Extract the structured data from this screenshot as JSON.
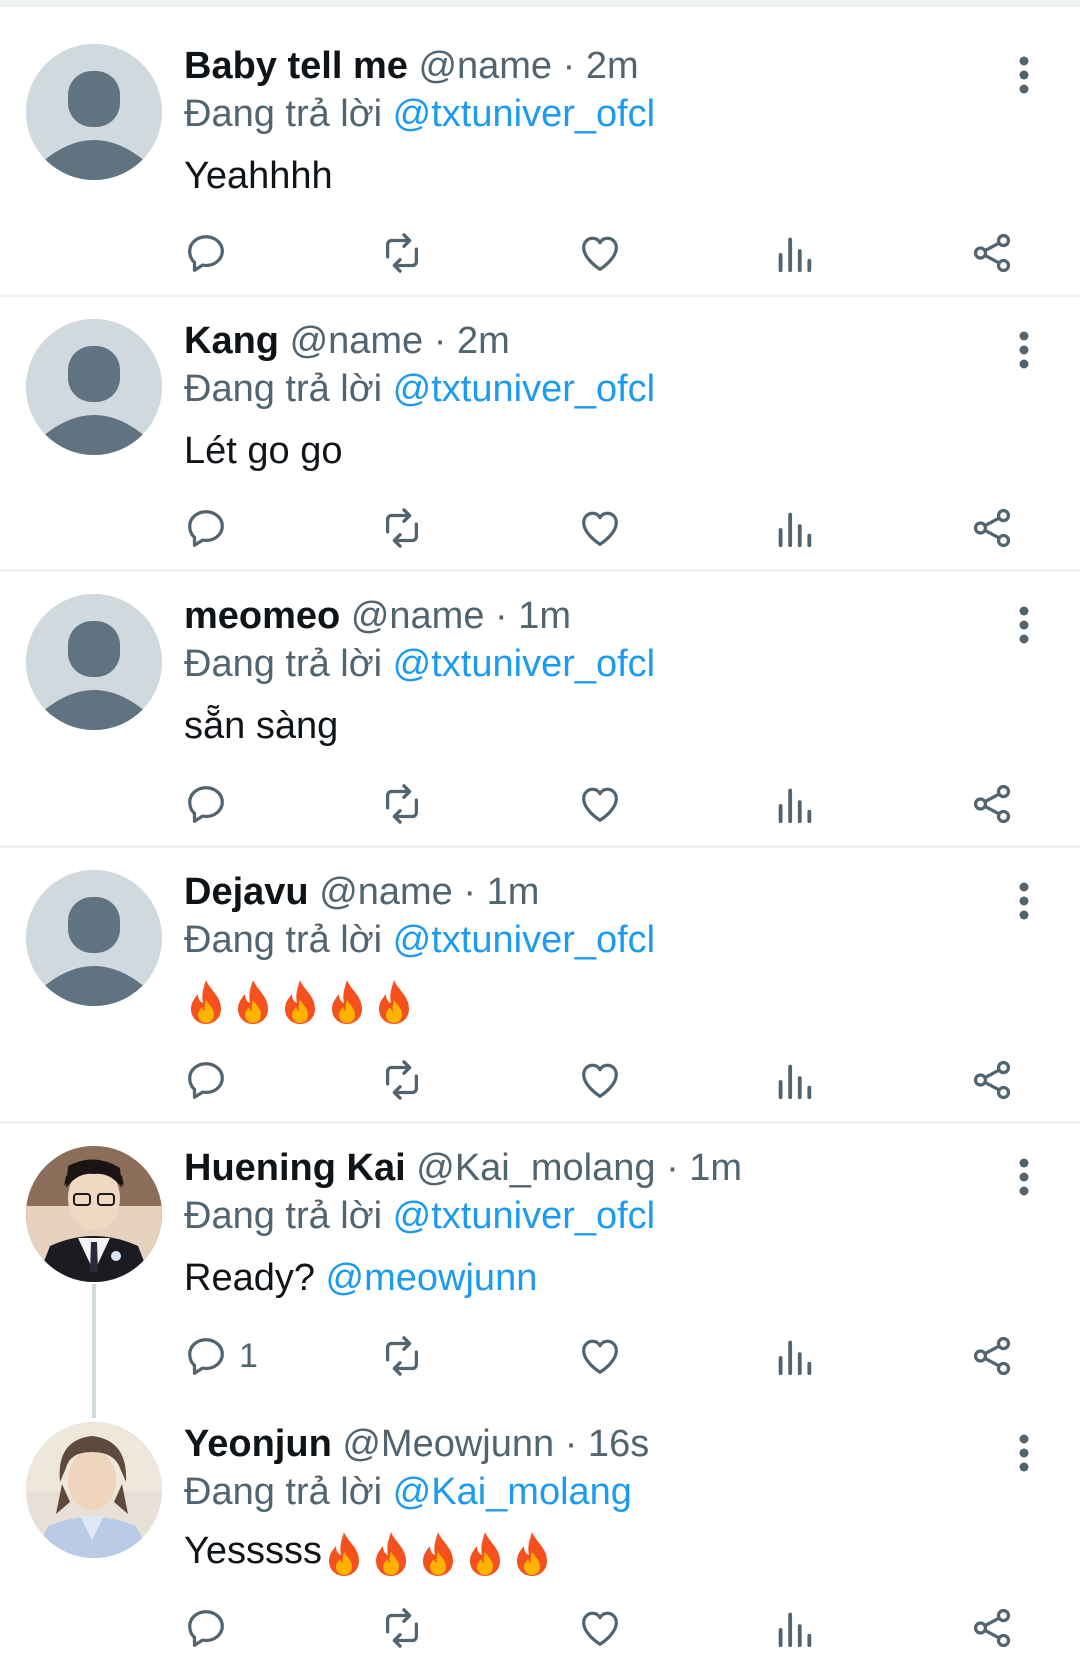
{
  "tweets": [
    {
      "name": "Baby tell me",
      "handle": "@name",
      "time": "· 2m",
      "reply_prefix": "Đang trả lời",
      "reply_to": "@txtuniver_ofcl",
      "text": "Yeahhhh",
      "reply_count": "",
      "avatar": "default-avatar"
    },
    {
      "name": "Kang",
      "handle": "@name",
      "time": "· 2m",
      "reply_prefix": "Đang trả lời",
      "reply_to": "@txtuniver_ofcl",
      "text": "Lét go go",
      "reply_count": "",
      "avatar": "default-avatar"
    },
    {
      "name": "meomeo",
      "handle": "@name",
      "time": "· 1m",
      "reply_prefix": "Đang trả lời",
      "reply_to": "@txtuniver_ofcl",
      "text": "sẵn sàng",
      "reply_count": "",
      "avatar": "default-avatar"
    },
    {
      "name": "Dejavu",
      "handle": "@name",
      "time": "· 1m",
      "reply_prefix": "Đang trả lời",
      "reply_to": "@txtuniver_ofcl",
      "text": "",
      "emoji": [
        "fire",
        "fire",
        "fire",
        "fire",
        "fire"
      ],
      "reply_count": "",
      "avatar": "default-avatar"
    },
    {
      "name": "Huening Kai",
      "handle": "@Kai_molang",
      "time": "· 1m",
      "reply_prefix": "Đang trả lời",
      "reply_to": "@txtuniver_ofcl",
      "text": "Ready?",
      "text_mention": "@meowjunn",
      "reply_count": "1",
      "avatar": "photo-avatar"
    },
    {
      "name": "Yeonjun",
      "handle": "@Meowjunn",
      "time": "· 16s",
      "reply_prefix": "Đang trả lời",
      "reply_to": "@Kai_molang",
      "text": "Yesssss",
      "emoji": [
        "fire",
        "fire",
        "fire",
        "fire",
        "fire"
      ],
      "reply_count": "",
      "avatar": "photo-avatar"
    }
  ],
  "icons": {
    "reply": "reply-icon",
    "retweet": "retweet-icon",
    "like": "heart-icon",
    "views": "analytics-icon",
    "share": "share-icon",
    "more": "more-vertical-icon"
  },
  "colors": {
    "link": "#1d9bf0",
    "secondary_text": "#536471",
    "divider": "#eff3f4",
    "avatar_placeholder": "#cfd9de"
  }
}
